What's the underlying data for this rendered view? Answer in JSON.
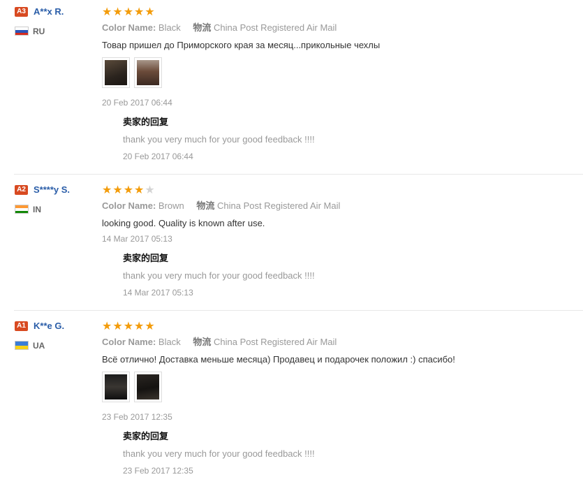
{
  "reviews": [
    {
      "badge": "A3",
      "name": "A**x R.",
      "country": "RU",
      "rating": 5,
      "color_label": "Color Name:",
      "color_value": "Black",
      "ship_label": "物流",
      "ship_value": "China Post Registered Air Mail",
      "text": "Товар пришел до Приморского края за месяц...прикольные чехлы",
      "date": "20 Feb 2017 06:44",
      "reply_title": "卖家的回复",
      "reply_text": "thank you very much for your good feedback !!!!",
      "reply_date": "20 Feb 2017 06:44"
    },
    {
      "badge": "A2",
      "name": "S****y S.",
      "country": "IN",
      "rating": 4,
      "color_label": "Color Name:",
      "color_value": "Brown",
      "ship_label": "物流",
      "ship_value": "China Post Registered Air Mail",
      "text": "looking good. Quality is known after use.",
      "date": "14 Mar 2017 05:13",
      "reply_title": "卖家的回复",
      "reply_text": "thank you very much for your good feedback !!!!",
      "reply_date": "14 Mar 2017 05:13"
    },
    {
      "badge": "A1",
      "name": "K**e G.",
      "country": "UA",
      "rating": 5,
      "color_label": "Color Name:",
      "color_value": "Black",
      "ship_label": "物流",
      "ship_value": "China Post Registered Air Mail",
      "text": "Всё отлично! Доставка меньше месяца) Продавец и подарочек положил :) спасибо!",
      "date": "23 Feb 2017 12:35",
      "reply_title": "卖家的回复",
      "reply_text": "thank you very much for your good feedback !!!!",
      "reply_date": "23 Feb 2017 12:35"
    }
  ],
  "colors": {
    "badge": "#d84a21",
    "name": "#2a5da8",
    "star_on": "#f39c0b",
    "star_off": "#d4d4d4"
  }
}
